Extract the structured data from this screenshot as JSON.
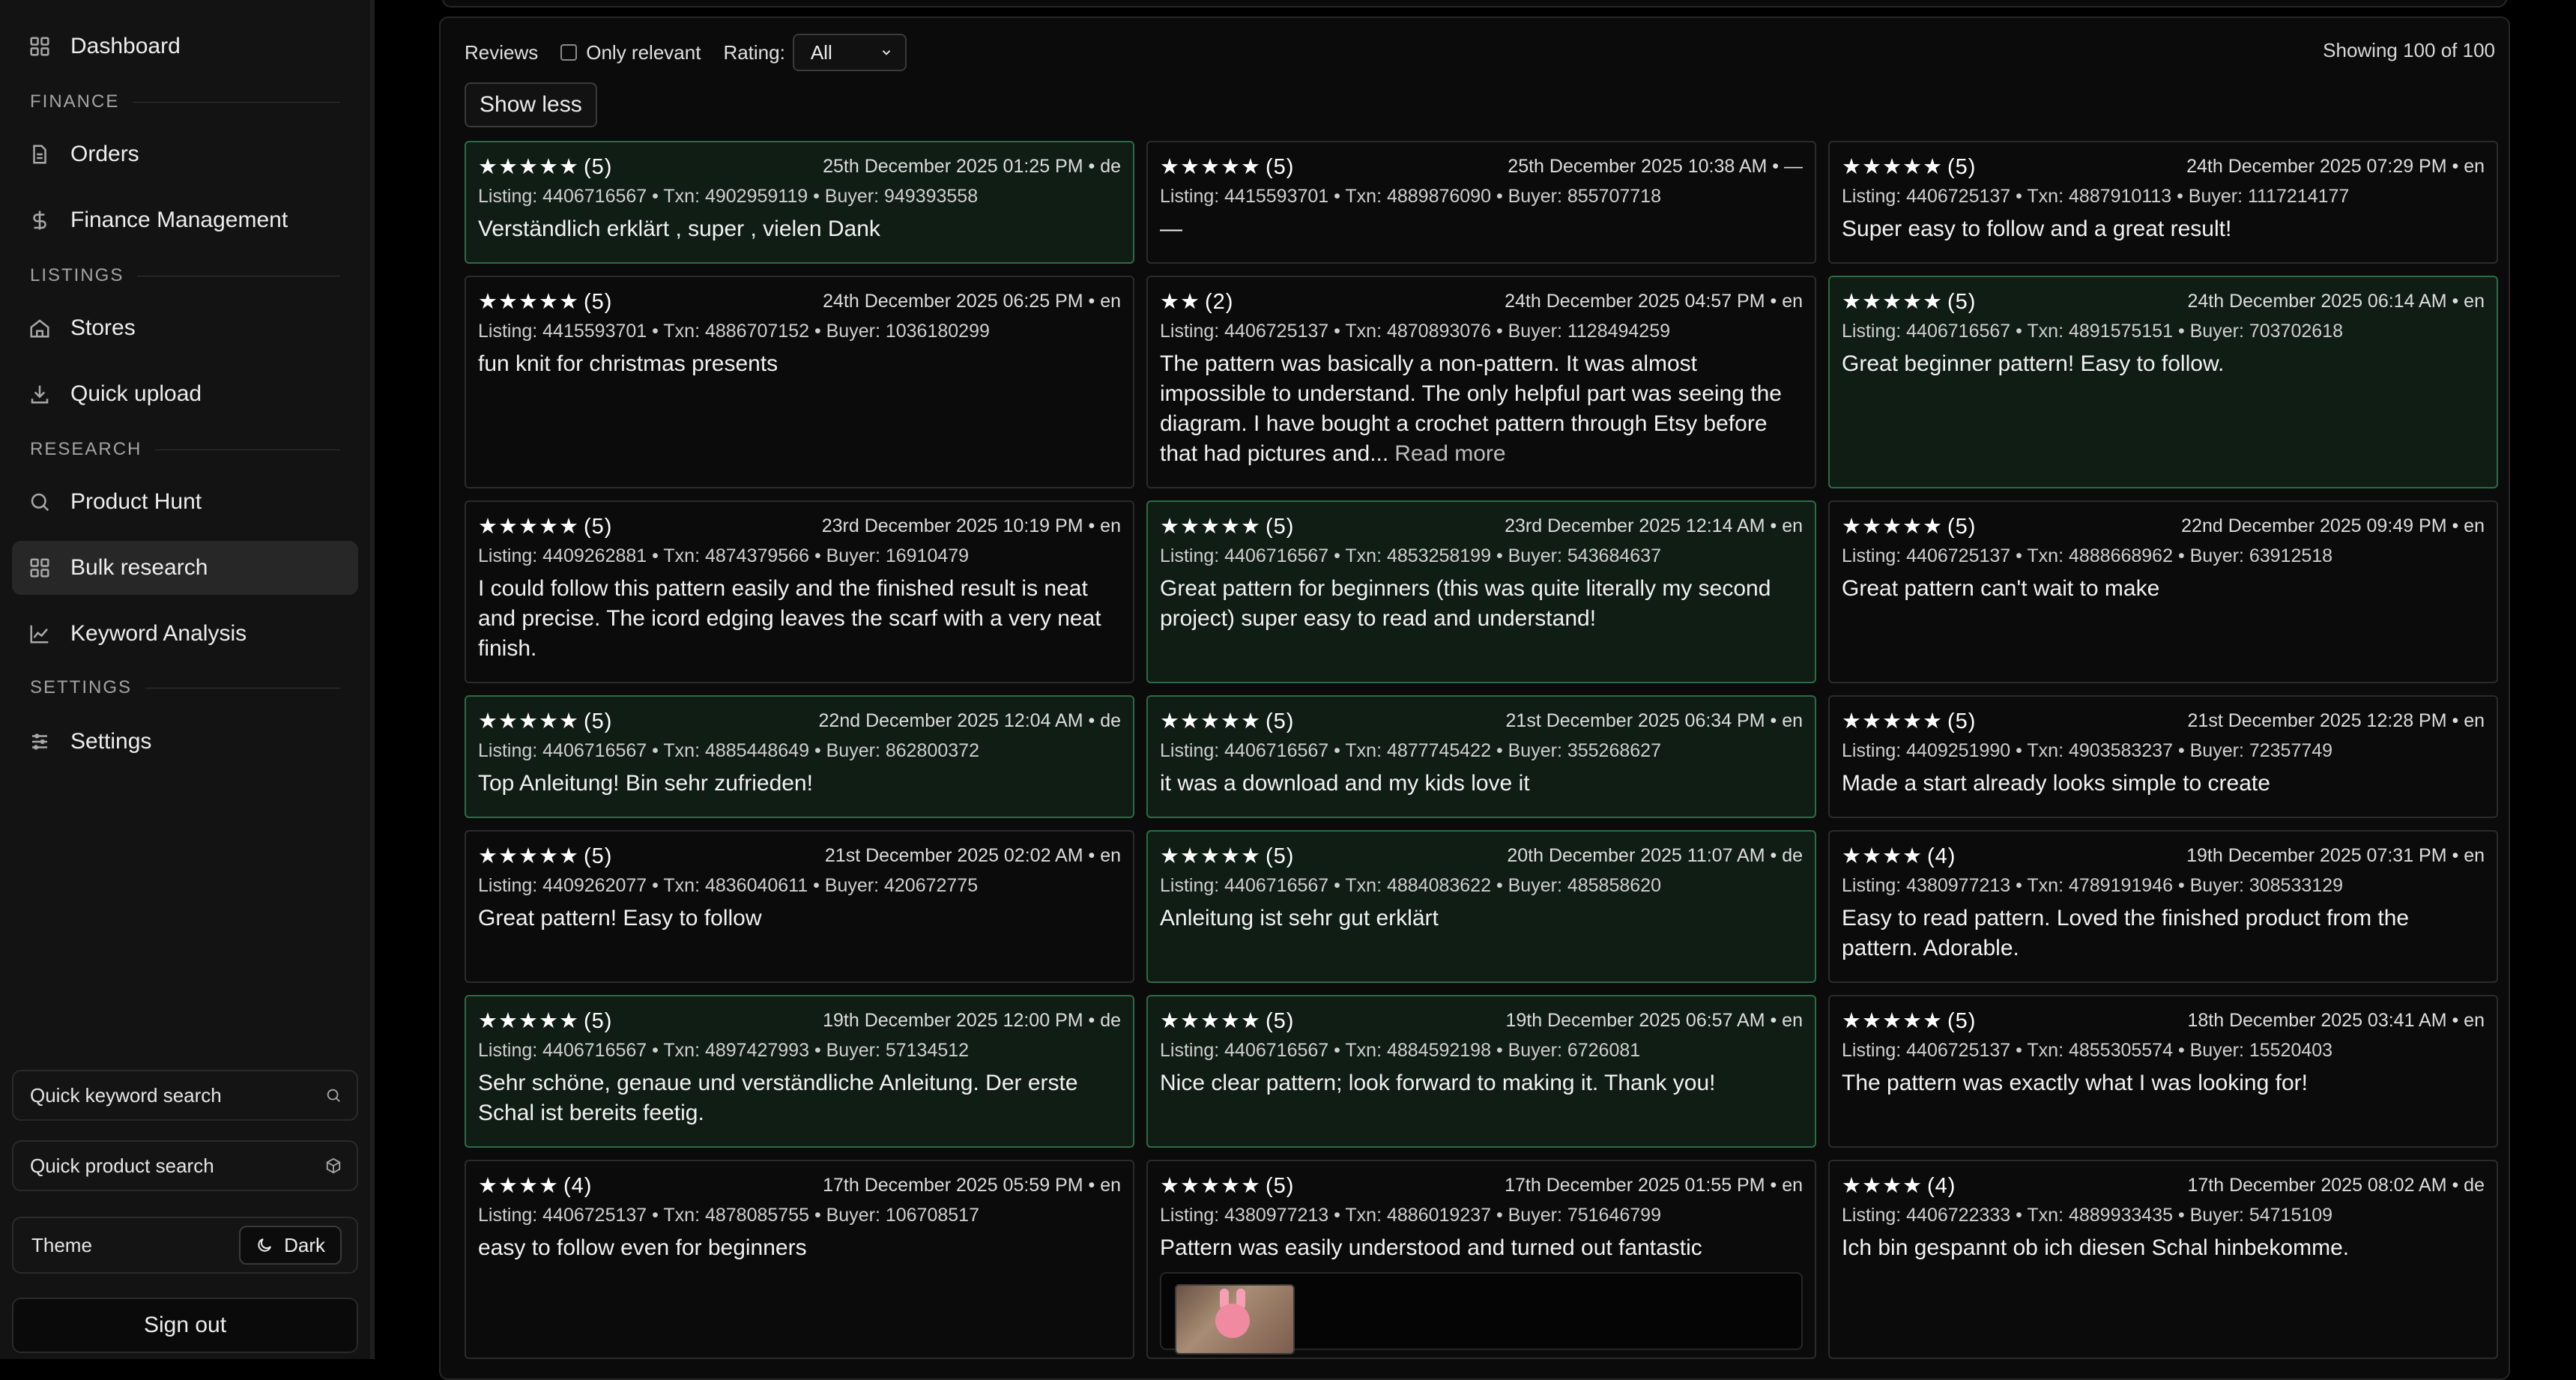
{
  "sidebar": {
    "items": [
      {
        "label": "Dashboard",
        "icon": "grid-icon"
      },
      {
        "label": "Orders",
        "icon": "document-icon"
      },
      {
        "label": "Finance Management",
        "icon": "dollar-icon"
      },
      {
        "label": "Stores",
        "icon": "home-icon"
      },
      {
        "label": "Quick upload",
        "icon": "download-icon"
      },
      {
        "label": "Product Hunt",
        "icon": "search-icon"
      },
      {
        "label": "Bulk research",
        "icon": "grid-icon",
        "active": true
      },
      {
        "label": "Keyword Analysis",
        "icon": "line-chart-icon"
      },
      {
        "label": "Settings",
        "icon": "sliders-icon"
      }
    ],
    "sections": {
      "finance": "FINANCE",
      "listings": "LISTINGS",
      "research": "RESEARCH",
      "settings": "SETTINGS"
    },
    "quick_keyword_search": "Quick keyword search",
    "quick_product_search": "Quick product search",
    "theme_label": "Theme",
    "theme_value": "Dark",
    "sign_out": "Sign out"
  },
  "reviews": {
    "title": "Reviews",
    "only_relevant_label": "Only relevant",
    "rating_label": "Rating:",
    "rating_value": "All",
    "showing": "Showing 100 of 100",
    "show_less": "Show less",
    "cards": [
      {
        "stars": "★★★★★",
        "count": "(5)",
        "date": "25th December 2025 01:25 PM • de",
        "meta": "Listing: 4406716567 • Txn: 4902959119 • Buyer: 949393558",
        "text": "Verständlich erklärt , super , vielen Dank",
        "highlight": true
      },
      {
        "stars": "★★★★★",
        "count": "(5)",
        "date": "25th December 2025 10:38 AM • —",
        "meta": "Listing: 4415593701 • Txn: 4889876090 • Buyer: 855707718",
        "text": "—",
        "highlight": false
      },
      {
        "stars": "★★★★★",
        "count": "(5)",
        "date": "24th December 2025 07:29 PM • en",
        "meta": "Listing: 4406725137 • Txn: 4887910113 • Buyer: 1117214177",
        "text": "Super easy to follow and a great result!",
        "highlight": false
      },
      {
        "stars": "★★★★★",
        "count": "(5)",
        "date": "24th December 2025 06:25 PM • en",
        "meta": "Listing: 4415593701 • Txn: 4886707152 • Buyer: 1036180299",
        "text": "fun knit for christmas presents",
        "highlight": false
      },
      {
        "stars": "★★",
        "count": "(2)",
        "date": "24th December 2025 04:57 PM • en",
        "meta": "Listing: 4406725137 • Txn: 4870893076 • Buyer: 1128494259",
        "text": "The pattern was basically a non-pattern. It was almost impossible to understand. The only helpful part was seeing the diagram. I have bought a crochet pattern through Etsy before that had pictures and...",
        "read_more": "Read more",
        "highlight": false
      },
      {
        "stars": "★★★★★",
        "count": "(5)",
        "date": "24th December 2025 06:14 AM • en",
        "meta": "Listing: 4406716567 • Txn: 4891575151 • Buyer: 703702618",
        "text": "Great beginner pattern! Easy to follow.",
        "highlight": true
      },
      {
        "stars": "★★★★★",
        "count": "(5)",
        "date": "23rd December 2025 10:19 PM • en",
        "meta": "Listing: 4409262881 • Txn: 4874379566 • Buyer: 16910479",
        "text": "I could follow this pattern easily and the finished result is neat and precise. The icord edging leaves the scarf with a very neat finish.",
        "highlight": false
      },
      {
        "stars": "★★★★★",
        "count": "(5)",
        "date": "23rd December 2025 12:14 AM • en",
        "meta": "Listing: 4406716567 • Txn: 4853258199 • Buyer: 543684637",
        "text": "Great pattern for beginners (this was quite literally my second project) super easy to read and understand!",
        "highlight": true
      },
      {
        "stars": "★★★★★",
        "count": "(5)",
        "date": "22nd December 2025 09:49 PM • en",
        "meta": "Listing: 4406725137 • Txn: 4888668962 • Buyer: 63912518",
        "text": "Great pattern can't wait to make",
        "highlight": false
      },
      {
        "stars": "★★★★★",
        "count": "(5)",
        "date": "22nd December 2025 12:04 AM • de",
        "meta": "Listing: 4406716567 • Txn: 4885448649 • Buyer: 862800372",
        "text": "Top Anleitung! Bin sehr zufrieden!",
        "highlight": true
      },
      {
        "stars": "★★★★★",
        "count": "(5)",
        "date": "21st December 2025 06:34 PM • en",
        "meta": "Listing: 4406716567 • Txn: 4877745422 • Buyer: 355268627",
        "text": "it was a download and my kids love it",
        "highlight": true
      },
      {
        "stars": "★★★★★",
        "count": "(5)",
        "date": "21st December 2025 12:28 PM • en",
        "meta": "Listing: 4409251990 • Txn: 4903583237 • Buyer: 72357749",
        "text": "Made a start already looks simple to create",
        "highlight": false
      },
      {
        "stars": "★★★★★",
        "count": "(5)",
        "date": "21st December 2025 02:02 AM • en",
        "meta": "Listing: 4409262077 • Txn: 4836040611 • Buyer: 420672775",
        "text": "Great pattern! Easy to follow",
        "highlight": false
      },
      {
        "stars": "★★★★★",
        "count": "(5)",
        "date": "20th December 2025 11:07 AM • de",
        "meta": "Listing: 4406716567 • Txn: 4884083622 • Buyer: 485858620",
        "text": "Anleitung ist sehr gut erklärt",
        "highlight": true
      },
      {
        "stars": "★★★★",
        "count": "(4)",
        "date": "19th December 2025 07:31 PM • en",
        "meta": "Listing: 4380977213 • Txn: 4789191946 • Buyer: 308533129",
        "text": "Easy to read pattern. Loved the finished product from the pattern. Adorable.",
        "highlight": false
      },
      {
        "stars": "★★★★★",
        "count": "(5)",
        "date": "19th December 2025 12:00 PM • de",
        "meta": "Listing: 4406716567 • Txn: 4897427993 • Buyer: 57134512",
        "text": "Sehr schöne, genaue und verständliche Anleitung. Der erste Schal ist bereits feetig.",
        "highlight": true
      },
      {
        "stars": "★★★★★",
        "count": "(5)",
        "date": "19th December 2025 06:57 AM • en",
        "meta": "Listing: 4406716567 • Txn: 4884592198 • Buyer: 6726081",
        "text": "Nice clear pattern; look forward to making it. Thank you!",
        "highlight": true
      },
      {
        "stars": "★★★★★",
        "count": "(5)",
        "date": "18th December 2025 03:41 AM • en",
        "meta": "Listing: 4406725137 • Txn: 4855305574 • Buyer: 15520403",
        "text": "The pattern was exactly what I was looking for!",
        "highlight": false
      },
      {
        "stars": "★★★★",
        "count": "(4)",
        "date": "17th December 2025 05:59 PM • en",
        "meta": "Listing: 4406725137 • Txn: 4878085755 • Buyer: 106708517",
        "text": "easy to follow even for beginners",
        "highlight": false
      },
      {
        "stars": "★★★★★",
        "count": "(5)",
        "date": "17th December 2025 01:55 PM • en",
        "meta": "Listing: 4380977213 • Txn: 4886019237 • Buyer: 751646799",
        "text": "Pattern was easily understood and turned out fantastic",
        "highlight": false,
        "has_image": true
      },
      {
        "stars": "★★★★",
        "count": "(4)",
        "date": "17th December 2025 08:02 AM • de",
        "meta": "Listing: 4406722333 • Txn: 4889933435 • Buyer: 54715109",
        "text": "Ich bin gespannt ob ich diesen Schal hinbekomme.",
        "highlight": false
      }
    ]
  },
  "colors": {
    "background": "#000000",
    "sidebar": "#131313",
    "card": "#0b0b0b",
    "highlight_card": "#0f1d15",
    "highlight_border": "#2d6a47"
  }
}
